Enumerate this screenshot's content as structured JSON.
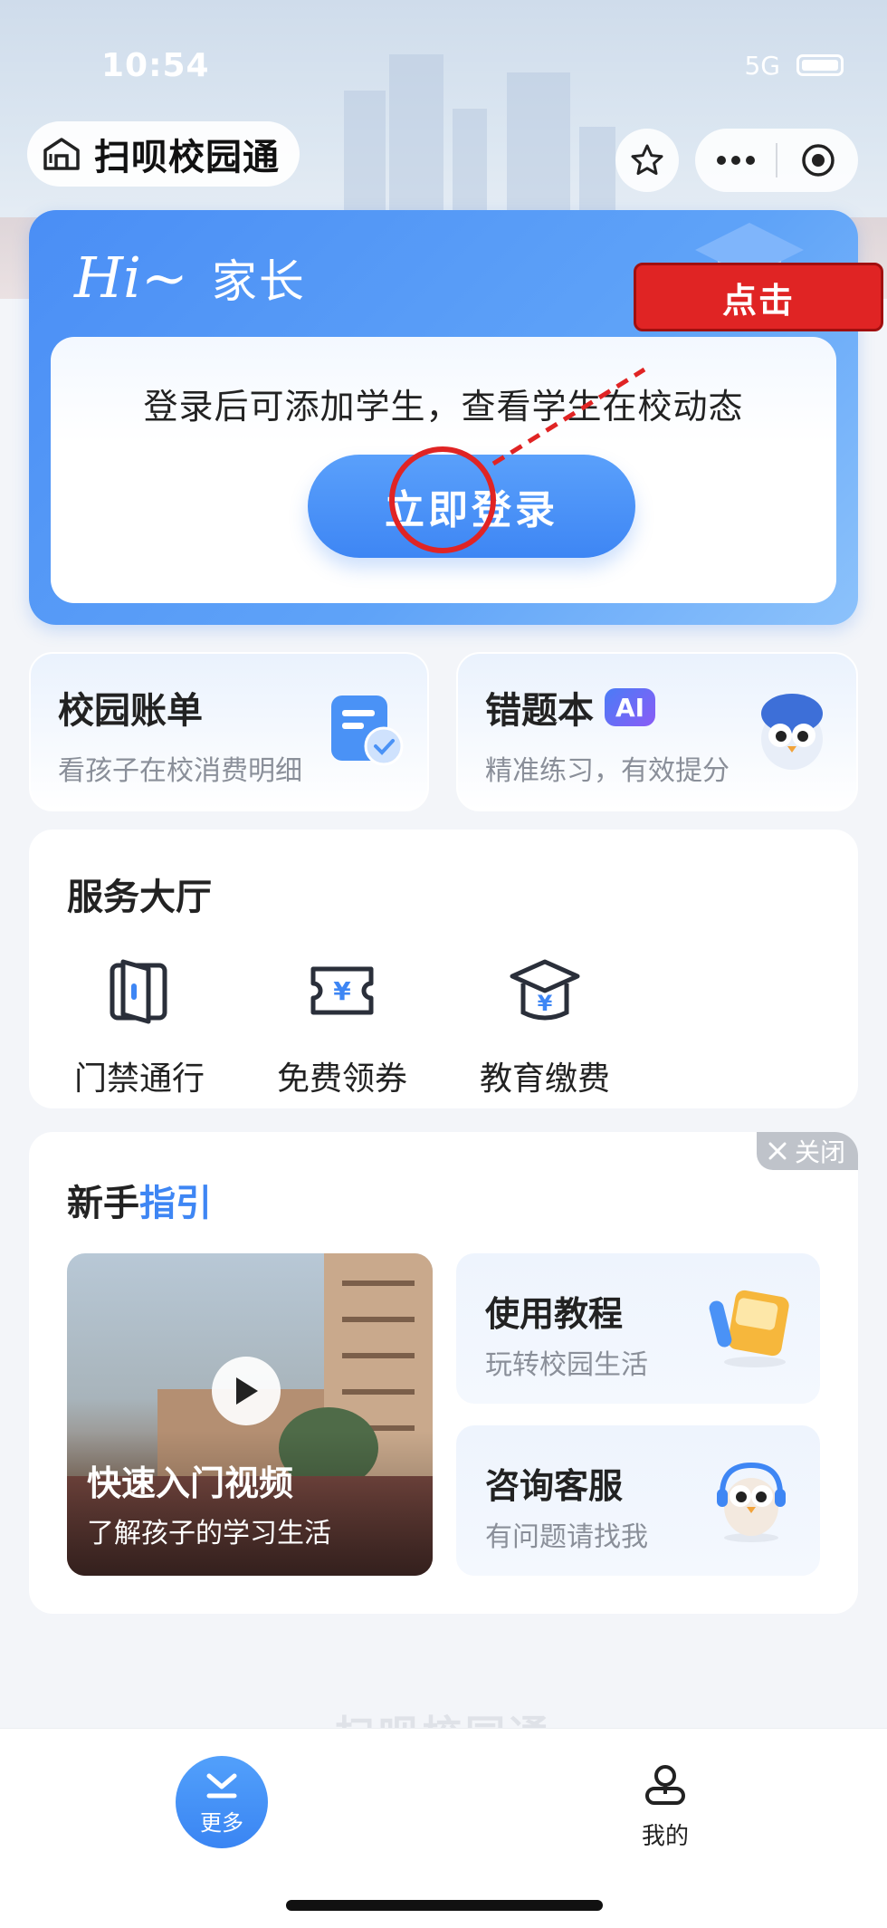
{
  "status_bar": {
    "time": "10:54",
    "network": "5G"
  },
  "header": {
    "app_title": "扫呗校园通"
  },
  "login_card": {
    "greeting": "Hi~",
    "role": "家长",
    "description": "登录后可添加学生，查看学生在校动态",
    "login_button": "立即登录"
  },
  "annotation": {
    "label": "点击"
  },
  "quick_cards": [
    {
      "title": "校园账单",
      "subtitle": "看孩子在校消费明细"
    },
    {
      "title": "错题本",
      "badge": "AI",
      "subtitle": "精准练习，有效提分"
    }
  ],
  "service_hall": {
    "title": "服务大厅",
    "items": [
      {
        "label": "门禁通行",
        "icon": "door-icon"
      },
      {
        "label": "免费领券",
        "icon": "coupon-icon"
      },
      {
        "label": "教育缴费",
        "icon": "graduation-cap-icon"
      }
    ]
  },
  "guide": {
    "title_prefix": "新手",
    "title_accent": "指引",
    "close_label": "关闭",
    "video": {
      "title": "快速入门视频",
      "subtitle": "了解孩子的学习生活"
    },
    "cards": [
      {
        "title": "使用教程",
        "subtitle": "玩转校园生活"
      },
      {
        "title": "咨询客服",
        "subtitle": "有问题请找我"
      }
    ]
  },
  "footer_watermark": "扫呗校园通",
  "tabbar": {
    "more": "更多",
    "mine": "我的"
  },
  "colors": {
    "primary": "#3e86f4",
    "annotation": "#e02424",
    "accent_text": "#3e86f4"
  }
}
